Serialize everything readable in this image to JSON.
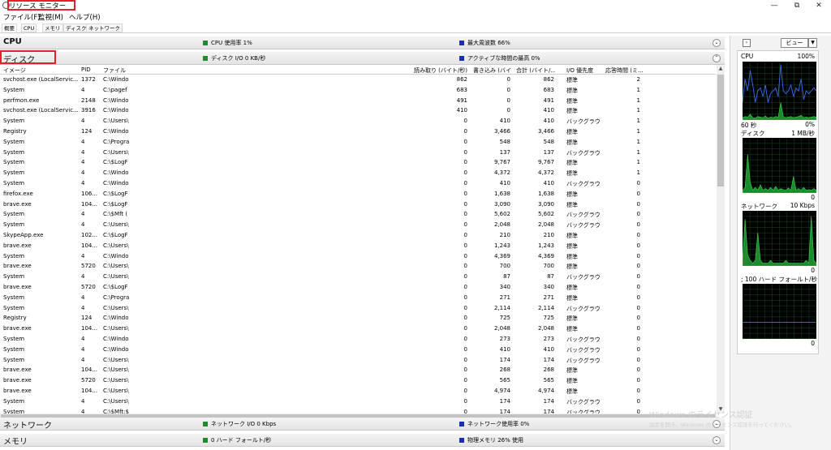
{
  "window": {
    "title": "リソース モニター",
    "controls": {
      "minimize": "—",
      "maximize": "⧉",
      "close": "✕"
    }
  },
  "menu": [
    "ファイル(F)",
    "監視(M)",
    "ヘルプ(H)"
  ],
  "tabs": [
    "概要",
    "CPU",
    "メモリ",
    "ディスク",
    "ネットワーク"
  ],
  "sections": {
    "cpu": {
      "title": "CPU",
      "stat1": "CPU 使用率 1%",
      "stat2": "最大周波数 66%",
      "expanded": false
    },
    "disk": {
      "title": "ディスク",
      "stat1": "ディスク I/O 0 KB/秒",
      "stat2": "アクティブな時間の最高 0%",
      "expanded": true
    },
    "network": {
      "title": "ネットワーク",
      "stat1": "ネットワーク I/O 0 Kbps",
      "stat2": "ネットワーク使用率 0%",
      "expanded": false
    },
    "memory": {
      "title": "メモリ",
      "stat1": "0 ハード フォールト/秒",
      "stat2": "物理メモリ 26% 使用",
      "expanded": false
    }
  },
  "disk_table": {
    "headers": [
      "イメージ",
      "PID",
      "ファイル",
      "読み取り (バイト/秒)",
      "書き込み (バイ...",
      "合計 (バイト/...",
      "I/O 優先度",
      "応答時間 (ミ..."
    ],
    "rows": [
      [
        "svchost.exe (LocalServic...",
        "1372",
        "C:\\Windo",
        "862",
        "0",
        "862",
        "標準",
        "2"
      ],
      [
        "System",
        "4",
        "C:\\pagef",
        "683",
        "0",
        "683",
        "標準",
        "1"
      ],
      [
        "perfmon.exe",
        "2148",
        "C:\\Windo",
        "491",
        "0",
        "491",
        "標準",
        "1"
      ],
      [
        "svchost.exe (LocalServic...",
        "3916",
        "C:\\Windo",
        "410",
        "0",
        "410",
        "標準",
        "1"
      ],
      [
        "System",
        "4",
        "C:\\Users\\",
        "0",
        "410",
        "410",
        "バックグラウン...",
        "1"
      ],
      [
        "Registry",
        "124",
        "C:\\Windo",
        "0",
        "3,466",
        "3,466",
        "標準",
        "1"
      ],
      [
        "System",
        "4",
        "C:\\Progra",
        "0",
        "548",
        "548",
        "標準",
        "1"
      ],
      [
        "System",
        "4",
        "C:\\Users\\",
        "0",
        "137",
        "137",
        "バックグラウン...",
        "1"
      ],
      [
        "System",
        "4",
        "C:\\$LogF",
        "0",
        "9,767",
        "9,767",
        "標準",
        "1"
      ],
      [
        "System",
        "4",
        "C:\\Windo",
        "0",
        "4,372",
        "4,372",
        "標準",
        "1"
      ],
      [
        "System",
        "4",
        "C:\\Windo",
        "0",
        "410",
        "410",
        "バックグラウン...",
        "0"
      ],
      [
        "firefox.exe",
        "106...",
        "C:\\$LogF",
        "0",
        "1,638",
        "1,638",
        "標準",
        "0"
      ],
      [
        "brave.exe",
        "104...",
        "C:\\$LogF",
        "0",
        "3,090",
        "3,090",
        "標準",
        "0"
      ],
      [
        "System",
        "4",
        "C:\\$Mft (",
        "0",
        "5,602",
        "5,602",
        "バックグラウン...",
        "0"
      ],
      [
        "System",
        "4",
        "C:\\Users\\",
        "0",
        "2,048",
        "2,048",
        "バックグラウン...",
        "0"
      ],
      [
        "SkypeApp.exe",
        "102...",
        "C:\\$LogF",
        "0",
        "210",
        "210",
        "標準",
        "0"
      ],
      [
        "brave.exe",
        "104...",
        "C:\\Users\\",
        "0",
        "1,243",
        "1,243",
        "標準",
        "0"
      ],
      [
        "System",
        "4",
        "C:\\Windo",
        "0",
        "4,369",
        "4,369",
        "標準",
        "0"
      ],
      [
        "brave.exe",
        "5720",
        "C:\\Users\\",
        "0",
        "700",
        "700",
        "標準",
        "0"
      ],
      [
        "System",
        "4",
        "C:\\Users\\",
        "0",
        "87",
        "87",
        "バックグラウン...",
        "0"
      ],
      [
        "brave.exe",
        "5720",
        "C:\\$LogF",
        "0",
        "340",
        "340",
        "標準",
        "0"
      ],
      [
        "System",
        "4",
        "C:\\Progra",
        "0",
        "271",
        "271",
        "標準",
        "0"
      ],
      [
        "System",
        "4",
        "C:\\Users\\",
        "0",
        "2,114",
        "2,114",
        "バックグラウン...",
        "0"
      ],
      [
        "Registry",
        "124",
        "C:\\Windo",
        "0",
        "725",
        "725",
        "標準",
        "0"
      ],
      [
        "brave.exe",
        "104...",
        "C:\\Users\\",
        "0",
        "2,048",
        "2,048",
        "標準",
        "0"
      ],
      [
        "System",
        "4",
        "C:\\Windo",
        "0",
        "273",
        "273",
        "バックグラウン...",
        "0"
      ],
      [
        "System",
        "4",
        "C:\\Windo",
        "0",
        "410",
        "410",
        "バックグラウン...",
        "0"
      ],
      [
        "System",
        "4",
        "C:\\Users\\",
        "0",
        "174",
        "174",
        "バックグラウン...",
        "0"
      ],
      [
        "brave.exe",
        "104...",
        "C:\\Users\\",
        "0",
        "268",
        "268",
        "標準",
        "0"
      ],
      [
        "brave.exe",
        "5720",
        "C:\\Users\\",
        "0",
        "565",
        "565",
        "標準",
        "0"
      ],
      [
        "brave.exe",
        "104...",
        "C:\\Users\\",
        "0",
        "4,974",
        "4,974",
        "標準",
        "0"
      ],
      [
        "System",
        "4",
        "C:\\Users\\",
        "0",
        "174",
        "174",
        "バックグラウン...",
        "0"
      ],
      [
        "System",
        "4",
        "C:\\$Mft:$BITMAP",
        "0",
        "174",
        "174",
        "バックグラウン...",
        "0"
      ]
    ]
  },
  "right_pane": {
    "view_button": "ビュー",
    "graphs": [
      {
        "label": "CPU",
        "top_value": "100%",
        "bottom_left": "60 秒",
        "bottom_right": "0%",
        "color": "#3b6cf5",
        "fill": "#1e8a2e",
        "line": [
          0.3,
          0.7,
          0.5,
          0.85,
          0.6,
          0.3,
          0.5,
          0.55,
          0.4,
          0.6,
          0.3,
          0.45,
          0.5,
          0.55,
          0.4,
          0.95,
          0.5,
          0.45,
          0.5,
          0.6,
          0.4,
          0.55,
          0.5,
          0.7,
          0.35,
          0.5,
          0.45,
          0.5,
          0.55,
          0.5
        ],
        "fill_series": [
          0.04,
          0.06,
          0.05,
          0.1,
          0.04,
          0.03,
          0.06,
          0.05,
          0.04,
          0.07,
          0.03,
          0.05,
          0.04,
          0.06,
          0.05,
          0.3,
          0.06,
          0.04,
          0.05,
          0.06,
          0.04,
          0.05,
          0.06,
          0.08,
          0.04,
          0.05,
          0.04,
          0.05,
          0.06,
          0.05
        ]
      },
      {
        "label": "ディスク",
        "top_value": "1 MB/秒",
        "bottom_left": "",
        "bottom_right": "0",
        "color": "#3b6cf5",
        "fill": "#1e8a2e",
        "line": [
          0,
          0,
          0,
          0,
          0,
          0,
          0,
          0,
          0,
          0,
          0,
          0,
          0,
          0,
          0,
          0,
          0,
          0,
          0,
          0,
          0,
          0,
          0,
          0,
          0,
          0,
          0,
          0,
          0,
          0
        ],
        "fill_series": [
          0.05,
          0.1,
          0.7,
          0.2,
          0.05,
          0.1,
          0.05,
          0.15,
          0.05,
          0.08,
          0.05,
          0.1,
          0.05,
          0.12,
          0.05,
          0.08,
          0.06,
          0.05,
          0.09,
          0.05,
          0.3,
          0.05,
          0.08,
          0.05,
          0.1,
          0.05,
          0.06,
          0.05,
          0.08,
          0.05
        ]
      },
      {
        "label": "ネットワーク",
        "top_value": "10 Kbps",
        "bottom_left": "",
        "bottom_right": "0",
        "color": "#3b6cf5",
        "fill": "#1e8a2e",
        "line": [
          0,
          0,
          0,
          0,
          0,
          0,
          0,
          0,
          0,
          0,
          0,
          0,
          0,
          0,
          0,
          0,
          0,
          0,
          0,
          0,
          0,
          0,
          0,
          0,
          0,
          0,
          0,
          0,
          0,
          0
        ],
        "fill_series": [
          0.1,
          0.85,
          0.2,
          0.1,
          0.05,
          0.1,
          0.6,
          0.1,
          0.05,
          0.05,
          0.05,
          0.1,
          0.05,
          0.05,
          0.05,
          0.05,
          0.05,
          0.1,
          0.05,
          0.05,
          0.05,
          0.05,
          0.05,
          0.05,
          0.05,
          0.1,
          0.05,
          0.9,
          0.1,
          0.05
        ]
      },
      {
        "label": "; 100 ハード フォールト/秒",
        "top_value": "",
        "bottom_left": "",
        "bottom_right": "0",
        "color": "#3b6cf5",
        "fill": "#1e8a2e",
        "line": [
          0.3,
          0.3,
          0.3,
          0.3,
          0.3,
          0.3,
          0.3,
          0.3,
          0.3,
          0.3,
          0.3,
          0.3,
          0.3,
          0.3,
          0.3,
          0.3,
          0.3,
          0.3,
          0.3,
          0.3,
          0.3,
          0.3,
          0.3,
          0.3,
          0.3,
          0.3,
          0.3,
          0.3,
          0.3,
          0.3
        ],
        "fill_series": [
          0,
          0,
          0,
          0,
          0,
          0,
          0,
          0,
          0,
          0,
          0,
          0,
          0,
          0,
          0,
          0,
          0,
          0,
          0,
          0,
          0,
          0,
          0,
          0,
          0,
          0,
          0,
          0,
          0,
          0
        ]
      }
    ]
  },
  "watermark": {
    "line1": "Windows のライセンス認証",
    "line2": "設定を開き、Windows のライセンス認証を行ってください。"
  }
}
